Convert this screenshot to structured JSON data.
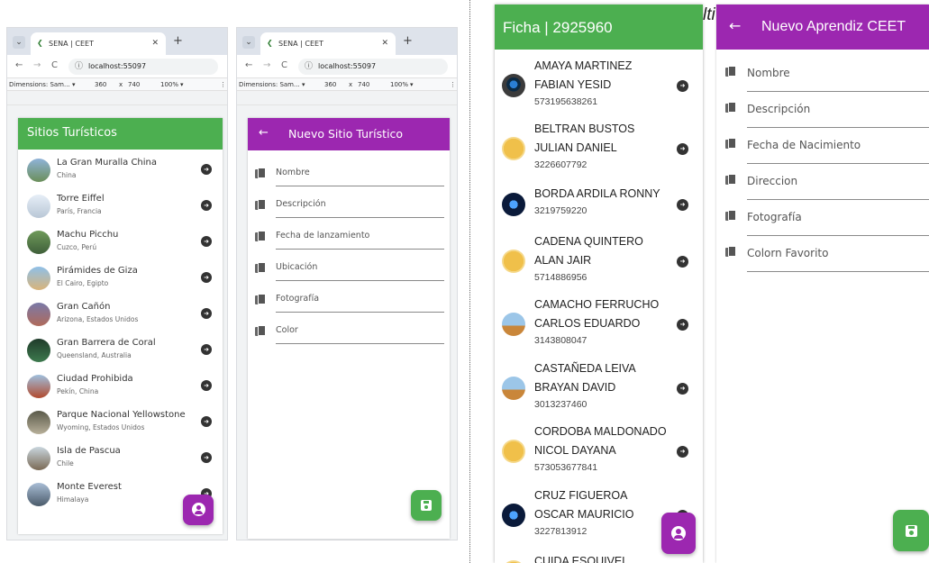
{
  "browser1": {
    "tab_title": "SENA | CEET",
    "url": "localhost:55097",
    "device": "Dimensions: Sam...",
    "width": "360",
    "x": "x",
    "height": "740",
    "zoom": "100%"
  },
  "browser2": {
    "tab_title": "SENA | CEET",
    "url": "localhost:55097",
    "device": "Dimensions: Sam...",
    "width": "360",
    "x": "x",
    "height": "740",
    "zoom": "100%"
  },
  "sitios": {
    "title": "Sitios Turísticos",
    "items": [
      {
        "name": "La Gran Muralla China",
        "place": "China"
      },
      {
        "name": "Torre Eiffel",
        "place": "París, Francia"
      },
      {
        "name": "Machu Picchu",
        "place": "Cuzco, Perú"
      },
      {
        "name": "Pirámides de Giza",
        "place": "El Cairo, Egipto"
      },
      {
        "name": "Gran Cañón",
        "place": "Arizona, Estados Unidos"
      },
      {
        "name": "Gran Barrera de Coral",
        "place": "Queensland, Australia"
      },
      {
        "name": "Ciudad Prohibida",
        "place": "Pekín, China"
      },
      {
        "name": "Parque Nacional Yellowstone",
        "place": "Wyoming, Estados Unidos"
      },
      {
        "name": "Isla de Pascua",
        "place": "Chile"
      },
      {
        "name": "Monte Everest",
        "place": "Himalaya"
      }
    ]
  },
  "nuevo_sitio": {
    "back": "←",
    "title": "Nuevo Sitio Turístico",
    "fields": [
      "Nombre",
      "Descripción",
      "Fecha de lanzamiento",
      "Ubicación",
      "Fotografía",
      "Color"
    ]
  },
  "ficha": {
    "title": "Ficha | 2925960",
    "learners": [
      {
        "name": "AMAYA MARTINEZ FABIAN YESID",
        "phone": "573195638261"
      },
      {
        "name": "BELTRAN BUSTOS JULIAN DANIEL",
        "phone": "3226607792"
      },
      {
        "name": "BORDA ARDILA RONNY",
        "phone": "3219759220"
      },
      {
        "name": "CADENA QUINTERO ALAN JAIR",
        "phone": "5714886956"
      },
      {
        "name": "CAMACHO FERRUCHO CARLOS EDUARDO",
        "phone": "3143808047"
      },
      {
        "name": "CASTAÑEDA LEIVA BRAYAN DAVID",
        "phone": "3013237460"
      },
      {
        "name": "CORDOBA MALDONADO NICOL DAYANA",
        "phone": "573053677841"
      },
      {
        "name": "CRUZ FIGUEROA OSCAR MAURICIO",
        "phone": "3227813912"
      },
      {
        "name": "CUIDA ESQUIVEL SAMUEL",
        "phone": ""
      }
    ]
  },
  "nuevo_aprendiz": {
    "back": "←",
    "title": "Nuevo Aprendiz CEET",
    "fields": [
      "Nombre",
      "Descripción",
      "Fecha de Nacimiento",
      "Direccion",
      "Fotografía",
      "Colorn Favorito"
    ]
  },
  "overlap_text": "lti",
  "colors": {
    "green": "#4caf50",
    "purple": "#9c27b0"
  }
}
